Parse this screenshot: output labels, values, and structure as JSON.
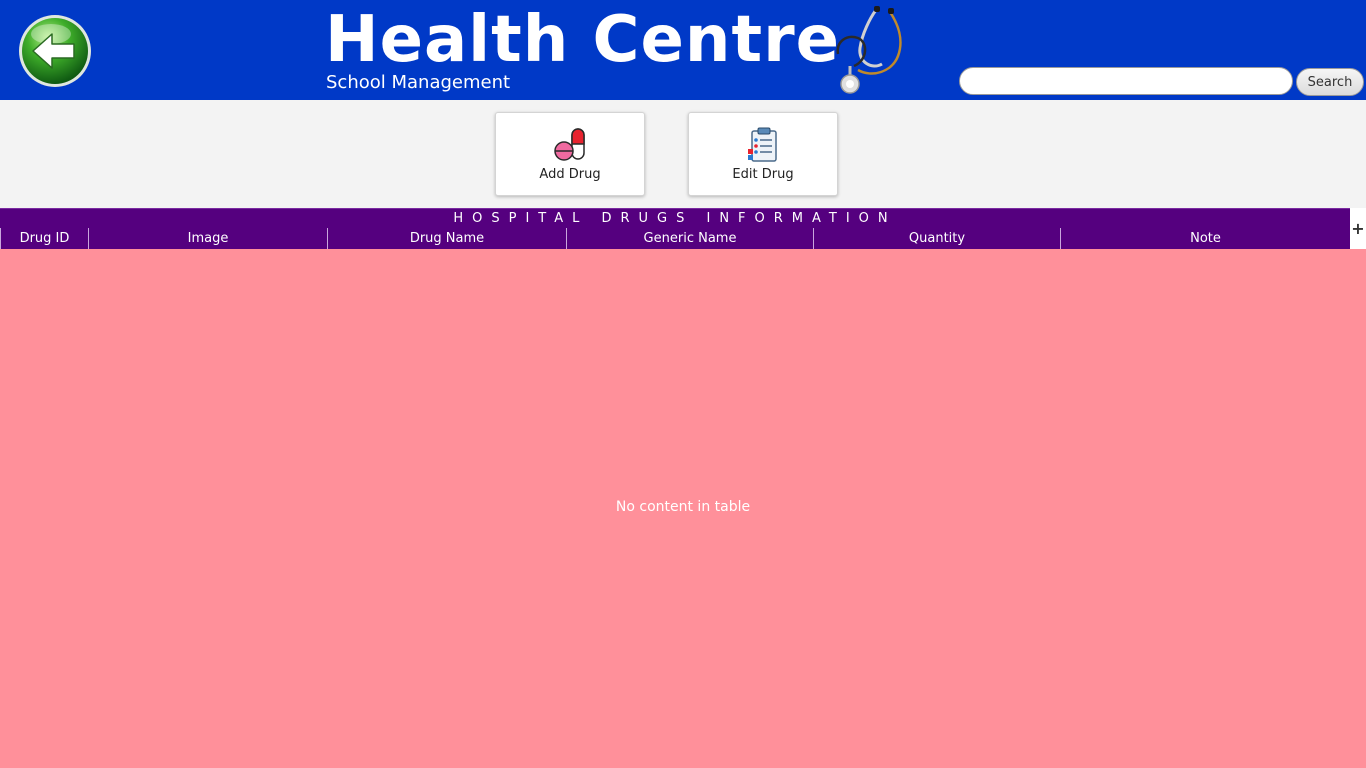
{
  "header": {
    "title": "Health Centre",
    "subtitle": "School Management",
    "back_icon": "back-arrow-icon",
    "logo_icon": "stethoscope-icon",
    "background_color": "#0039c7"
  },
  "search": {
    "value": "",
    "placeholder": "",
    "button_label": "Search"
  },
  "toolbar": {
    "buttons": [
      {
        "label": "Add Drug",
        "icon": "pill-icon"
      },
      {
        "label": "Edit Drug",
        "icon": "clipboard-icon"
      }
    ]
  },
  "table": {
    "title": "HOSPITAL DRUGS INFORMATION",
    "columns": [
      "Drug ID",
      "Image",
      "Drug Name",
      "Generic Name",
      "Quantity",
      "Note"
    ],
    "rows": [],
    "empty_message": "No content in table",
    "corner_button": "+",
    "header_color": "#55007f",
    "body_color": "#ff909a"
  }
}
